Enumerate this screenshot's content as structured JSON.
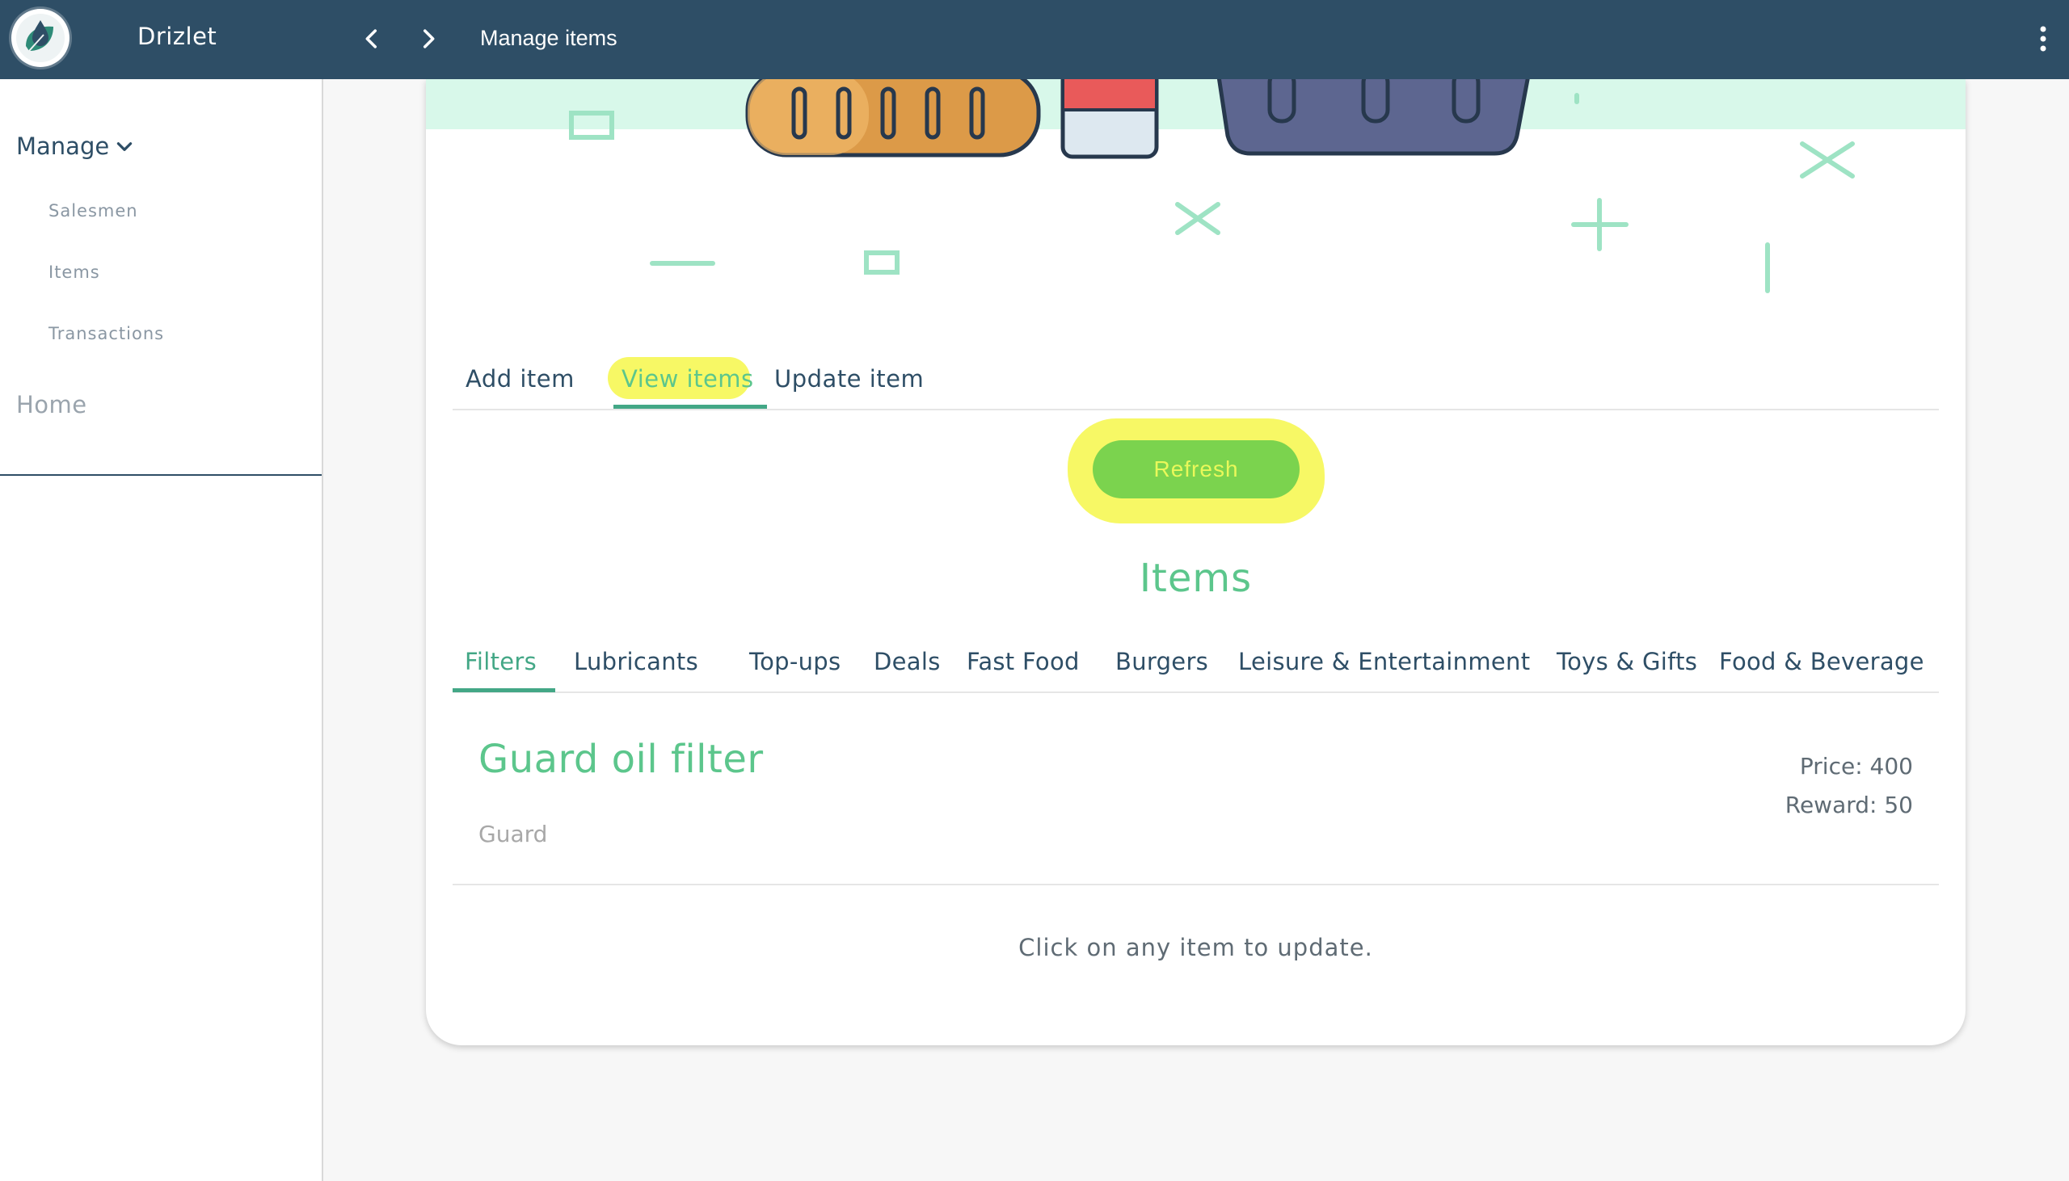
{
  "app": {
    "name": "Drizlet",
    "page_title": "Manage items"
  },
  "sidebar": {
    "manage_label": "Manage",
    "items": [
      {
        "label": "Salesmen"
      },
      {
        "label": "Items"
      },
      {
        "label": "Transactions"
      }
    ],
    "home_label": "Home"
  },
  "tabs": [
    {
      "label": "Add item",
      "active": false
    },
    {
      "label": "View items",
      "active": true
    },
    {
      "label": "Update item",
      "active": false
    }
  ],
  "refresh_label": "Refresh",
  "section_title": "Items",
  "categories": [
    {
      "label": "Filters",
      "active": true
    },
    {
      "label": "Lubricants"
    },
    {
      "label": "Top-ups"
    },
    {
      "label": "Deals"
    },
    {
      "label": "Fast Food"
    },
    {
      "label": "Burgers"
    },
    {
      "label": "Leisure & Entertainment"
    },
    {
      "label": "Toys & Gifts"
    },
    {
      "label": "Food & Beverage"
    }
  ],
  "item": {
    "name": "Guard oil filter",
    "brand": "Guard",
    "price": "Price: 400",
    "reward": "Reward: 50"
  },
  "hint": "Click on any item to update.",
  "colors": {
    "topbar": "#2e4e66",
    "accent": "#5cc68c",
    "accent_dark": "#43a786",
    "refresh": "#7bd34e",
    "highlight": "#f6f74a"
  }
}
